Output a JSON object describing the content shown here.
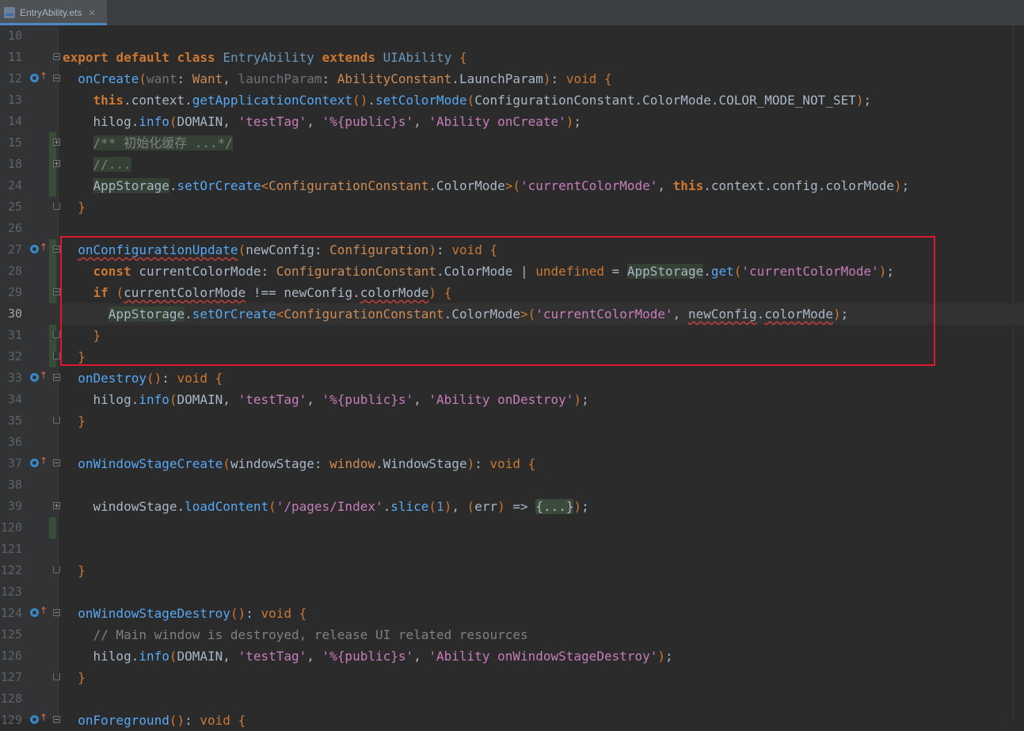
{
  "tab": {
    "filename": "EntryAbility.ets",
    "close": "✕"
  },
  "line_numbers": [
    "10",
    "11",
    "12",
    "13",
    "14",
    "15",
    "18",
    "24",
    "25",
    "26",
    "27",
    "28",
    "29",
    "30",
    "31",
    "32",
    "33",
    "34",
    "35",
    "36",
    "37",
    "38",
    "39",
    "120",
    "121",
    "122",
    "123",
    "124",
    "125",
    "126",
    "127",
    "128",
    "129"
  ],
  "code": {
    "l11": {
      "export": "export",
      "default": "default",
      "class": "class",
      "name": "EntryAbility",
      "extends": "extends",
      "base": "UIAbility",
      "brace": " {"
    },
    "l12": {
      "method": "onCreate",
      "p1": "want",
      "t1": "Want",
      "p2": "launchParam",
      "t2a": "AbilityConstant",
      "t2b": "LaunchParam",
      "ret": "void"
    },
    "l13": {
      "this": "this",
      "ctx": ".context.",
      "f1": "getApplicationContext",
      "f2": "setColorMode",
      "arg": "ConfigurationConstant.ColorMode.COLOR_MODE_NOT_SET"
    },
    "l14": {
      "obj": "hilog.",
      "f": "info",
      "a1": "DOMAIN",
      "s1": "'testTag'",
      "s2": "'%{public}s'",
      "s3": "'Ability onCreate'"
    },
    "l15": "/** 初始化缓存 ...*/",
    "l18": "//...",
    "l24": {
      "obj": "AppStorage",
      "f": "setOrCreate",
      "gen": "ConfigurationConstant",
      "genb": "ColorMode",
      "s1": "'currentColorMode'",
      "this": "this",
      "rest": ".context.config.colorMode"
    },
    "l27": {
      "method": "onConfigurationUpdate",
      "p": "newConfig",
      "t": "Configuration",
      "ret": "void"
    },
    "l28": {
      "const": "const",
      "var": "currentColorMode",
      "t1": "ConfigurationConstant",
      "t1b": "ColorMode",
      "undef": "undefined",
      "obj": "AppStorage",
      "f": "get",
      "s": "'currentColorMode'"
    },
    "l29": {
      "if": "if",
      "a": "currentColorMode",
      "op": " !== ",
      "b": "newConfig",
      "c": "colorMode"
    },
    "l30": {
      "obj": "AppStorage",
      "f": "setOrCreate",
      "gen": "ConfigurationConstant",
      "genb": "ColorMode",
      "s": "'currentColorMode'",
      "b": "newConfig",
      "c": "colorMode"
    },
    "l33": {
      "method": "onDestroy",
      "ret": "void"
    },
    "l34": {
      "obj": "hilog.",
      "f": "info",
      "a1": "DOMAIN",
      "s1": "'testTag'",
      "s2": "'%{public}s'",
      "s3": "'Ability onDestroy'"
    },
    "l37": {
      "method": "onWindowStageCreate",
      "p": "windowStage",
      "t": "window",
      "tb": "WindowStage",
      "ret": "void"
    },
    "l39": {
      "obj": "windowStage.",
      "f": "loadContent",
      "s": "'/pages/Index'",
      "f2": "slice",
      "n": "1",
      "err": "err",
      "arrow": " => ",
      "fold": "{...}"
    },
    "l124": {
      "method": "onWindowStageDestroy",
      "ret": "void"
    },
    "l125": "// Main window is destroyed, release UI related resources",
    "l126": {
      "obj": "hilog.",
      "f": "info",
      "a1": "DOMAIN",
      "s1": "'testTag'",
      "s2": "'%{public}s'",
      "s3": "'Ability onWindowStageDestroy'"
    },
    "l129": {
      "method": "onForeground",
      "ret": "void"
    }
  }
}
